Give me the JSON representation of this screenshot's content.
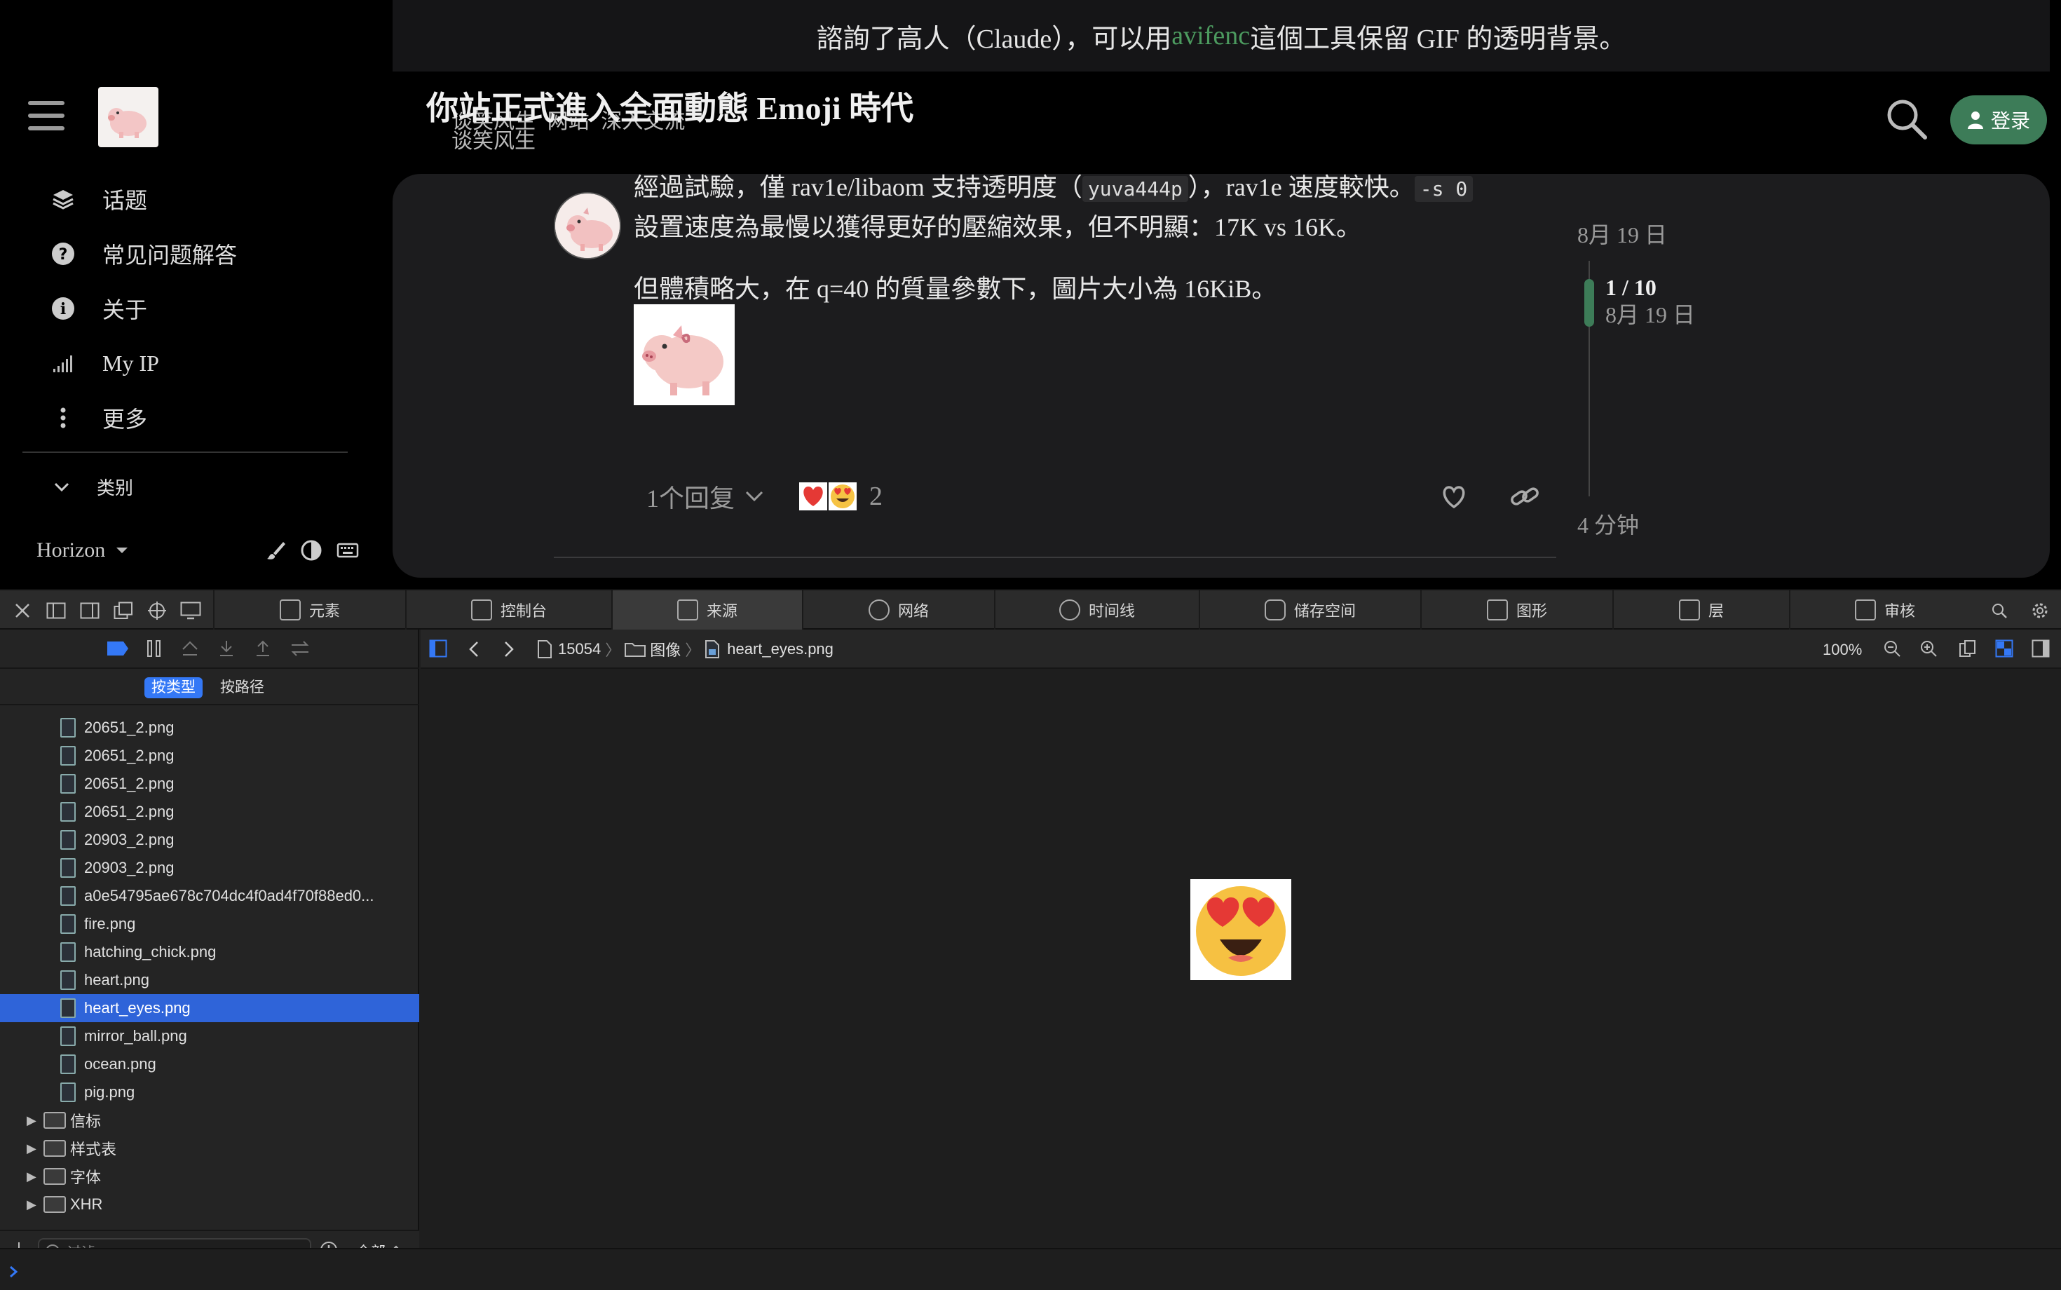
{
  "notice": {
    "text_before": "諮詢了高人（Claude），可以用 ",
    "link": "avifenc",
    "text_after": " 這個工具保留 GIF 的透明背景。"
  },
  "sidebar": {
    "items": [
      {
        "label": "话题",
        "icon": "layers-icon"
      },
      {
        "label": "常见问题解答",
        "icon": "question-circle-icon"
      },
      {
        "label": "关于",
        "icon": "info-circle-icon"
      },
      {
        "label": "My IP",
        "icon": "signal-bars-icon"
      },
      {
        "label": "更多",
        "icon": "vertical-ellipsis-icon"
      }
    ],
    "categories_label": "类别",
    "theme_name": "Horizon"
  },
  "header": {
    "title": "你站正式進入全面動態 Emoji 時代",
    "categories": "谈笑风生  网站  深入交流",
    "category_sub": "谈笑风生",
    "login_label": "登录"
  },
  "post": {
    "line1_a": "經過試驗，僅 rav1e/libaom 支持透明度（",
    "line1_code": "yuva444p",
    "line1_b": "），rav1e 速度較快。",
    "line1_code2": "-s 0",
    "line2": "設置速度為最慢以獲得更好的壓縮效果，但不明顯：17K vs 16K。",
    "line3": "但體積略大，在 q=40 的質量參數下，圖片大小為 16KiB。",
    "replies_label": "1个回复",
    "reaction_count": "2"
  },
  "timeline": {
    "top_date": "8月 19 日",
    "position": "1 / 10",
    "position_date": "8月 19 日",
    "bottom_label": "4 分钟"
  },
  "devtools": {
    "tabs": [
      {
        "label": "元素",
        "icon": "elements-icon"
      },
      {
        "label": "控制台",
        "icon": "console-icon"
      },
      {
        "label": "来源",
        "icon": "sources-icon"
      },
      {
        "label": "网络",
        "icon": "network-icon"
      },
      {
        "label": "时间线",
        "icon": "timeline-icon"
      },
      {
        "label": "储存空间",
        "icon": "storage-icon"
      },
      {
        "label": "图形",
        "icon": "graphics-icon"
      },
      {
        "label": "层",
        "icon": "layers-icon"
      },
      {
        "label": "审核",
        "icon": "audit-icon"
      }
    ],
    "active_tab": "来源",
    "group_by_type": "按类型",
    "group_by_path": "按路径",
    "files": [
      "20651_2.png",
      "20651_2.png",
      "20651_2.png",
      "20651_2.png",
      "20903_2.png",
      "20903_2.png",
      "a0e54795ae678c704dc4f0ad4f70f88ed0...",
      "fire.png",
      "hatching_chick.png",
      "heart.png",
      "heart_eyes.png",
      "mirror_ball.png",
      "ocean.png",
      "pig.png"
    ],
    "selected_file": "heart_eyes.png",
    "folders": [
      "信标",
      "样式表",
      "字体",
      "XHR"
    ],
    "filter_placeholder": "过滤",
    "filter_scope": "全部",
    "breadcrumb": [
      "15054",
      "图像",
      "heart_eyes.png"
    ],
    "zoom": "100%"
  },
  "colors": {
    "accent": "#3d7c58",
    "selection": "#2f64d9",
    "link": "#4c9a5f"
  }
}
